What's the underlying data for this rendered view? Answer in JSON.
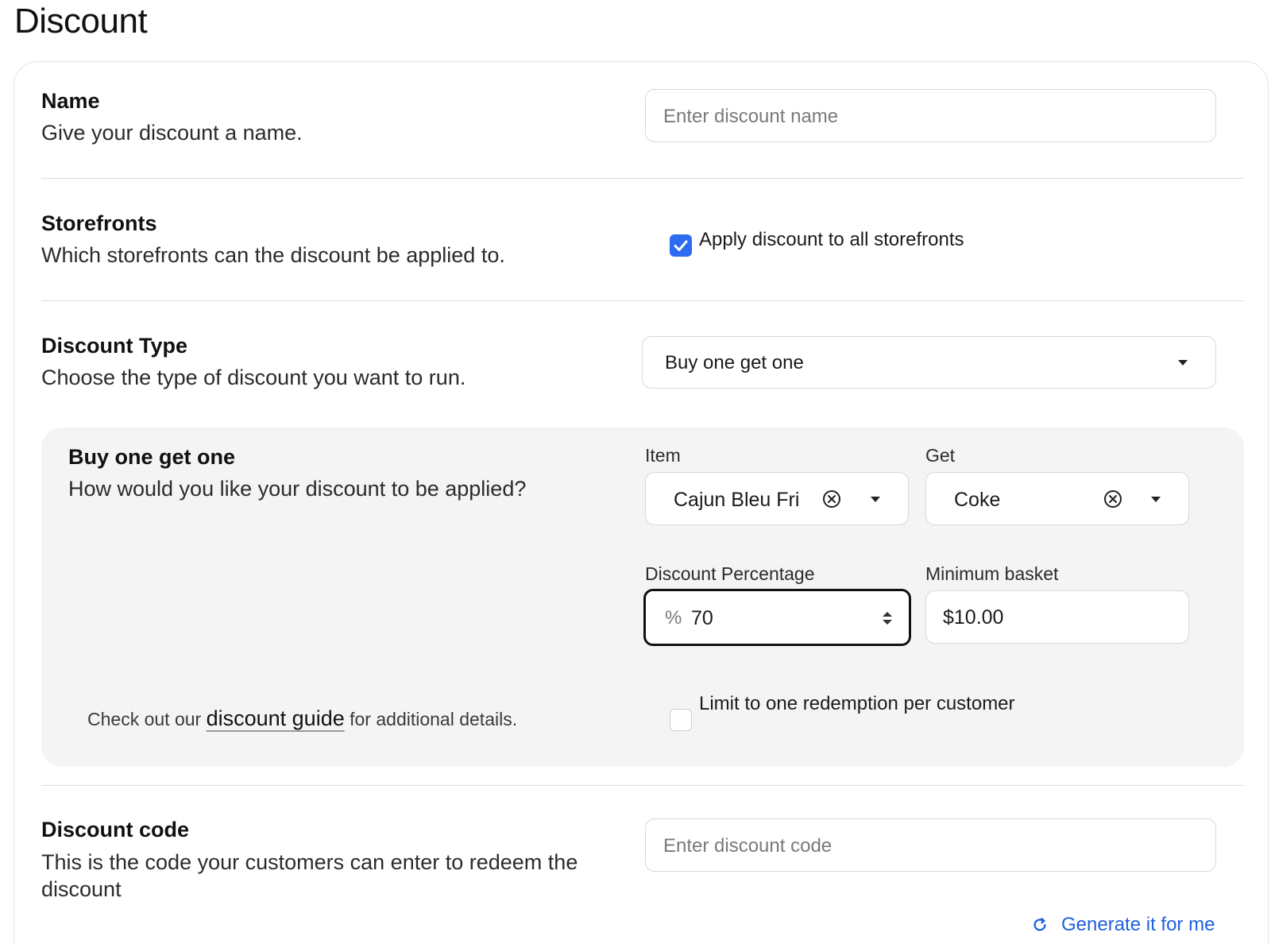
{
  "page": {
    "title": "Discount"
  },
  "name_section": {
    "title": "Name",
    "description": "Give your discount a name.",
    "input_placeholder": "Enter discount name"
  },
  "storefronts_section": {
    "title": "Storefronts",
    "description": "Which storefronts can the discount be applied to.",
    "checkbox_label": "Apply discount to all storefronts",
    "checked": true
  },
  "discount_type_section": {
    "title": "Discount Type",
    "description": "Choose the type of discount you want to run.",
    "selected": "Buy one get one"
  },
  "bogo_panel": {
    "title": "Buy one get one",
    "description": "How would you like your discount to be applied?",
    "item_label": "Item",
    "item_value": "Cajun Bleu Fri",
    "get_label": "Get",
    "get_value": "Coke",
    "percentage_label": "Discount Percentage",
    "percentage_prefix": "%",
    "percentage_value": "70",
    "min_basket_label": "Minimum basket",
    "min_basket_value": "$10.00",
    "guide_prefix": "Check out our ",
    "guide_link": "discount guide",
    "guide_suffix": " for additional details.",
    "limit_label": "Limit to one redemption per customer",
    "limit_checked": false
  },
  "discount_code_section": {
    "title": "Discount code",
    "description": "This is the code your customers can enter to redeem the discount",
    "input_placeholder": "Enter discount code",
    "generate_label": "Generate it for me"
  },
  "colors": {
    "accent": "#2b6cf0",
    "link": "#1f5fe0"
  },
  "icons": [
    "check-icon",
    "caret-down-icon",
    "clear-circle-x-icon",
    "stepper-icon",
    "refresh-icon"
  ]
}
